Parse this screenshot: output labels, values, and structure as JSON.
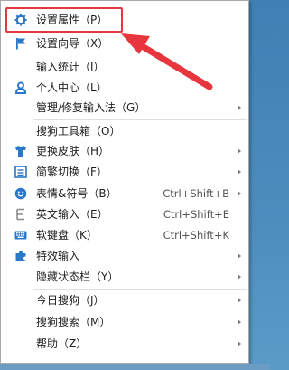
{
  "menu": {
    "items": [
      {
        "label": "设置属性（P）",
        "icon": "gear-icon",
        "shortcut": "",
        "submenu": false
      },
      {
        "label": "设置向导（X）",
        "icon": "flag-icon",
        "shortcut": "",
        "submenu": false
      },
      {
        "label": "输入统计（I）",
        "icon": "",
        "shortcut": "",
        "submenu": false
      },
      {
        "label": "个人中心（L）",
        "icon": "user-icon",
        "shortcut": "",
        "submenu": false
      },
      {
        "label": "管理/修复输入法（G）",
        "icon": "",
        "shortcut": "",
        "submenu": true
      },
      {
        "label": "搜狗工具箱（O）",
        "icon": "",
        "shortcut": "",
        "submenu": false
      },
      {
        "label": "更换皮肤（H）",
        "icon": "shirt-icon",
        "shortcut": "",
        "submenu": true
      },
      {
        "label": "简繁切换（F）",
        "icon": "simplified-traditional-icon",
        "shortcut": "",
        "submenu": true
      },
      {
        "label": "表情&符号（B）",
        "icon": "smiley-icon",
        "shortcut": "Ctrl+Shift+B",
        "submenu": true
      },
      {
        "label": "英文输入（E）",
        "icon": "english-e-icon",
        "shortcut": "Ctrl+Shift+E",
        "submenu": true
      },
      {
        "label": "软键盘（K）",
        "icon": "keyboard-icon",
        "shortcut": "Ctrl+Shift+K",
        "submenu": true
      },
      {
        "label": "特效输入",
        "icon": "puzzle-icon",
        "shortcut": "",
        "submenu": true
      },
      {
        "label": "隐藏状态栏（Y）",
        "icon": "",
        "shortcut": "",
        "submenu": true
      },
      {
        "label": "今日搜狗（J）",
        "icon": "",
        "shortcut": "",
        "submenu": true
      },
      {
        "label": "搜狗搜索（M）",
        "icon": "",
        "shortcut": "",
        "submenu": true
      },
      {
        "label": "帮助（Z）",
        "icon": "",
        "shortcut": "",
        "submenu": true
      }
    ]
  },
  "colors": {
    "icon_blue": "#2a78c8",
    "highlight_red": "#e8363e",
    "arrow_red": "#e8363e"
  }
}
